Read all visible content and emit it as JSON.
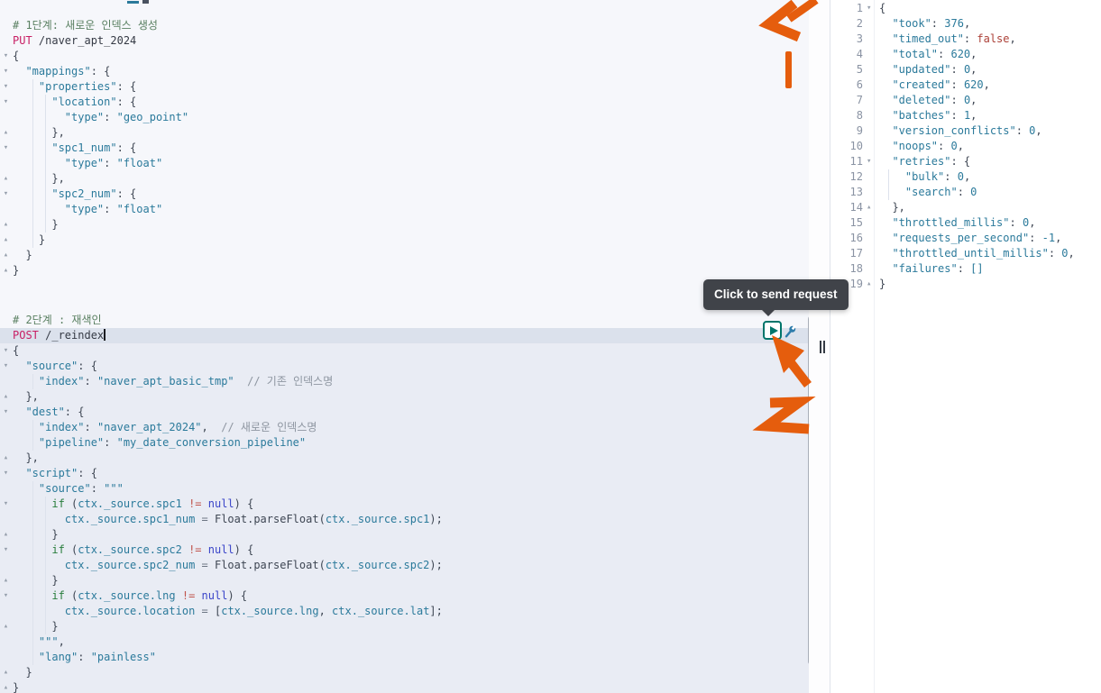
{
  "tooltip": {
    "text": "Click to send request"
  },
  "colors": {
    "accent_orange": "#e55d0d",
    "teal_action": "#00756b",
    "selection_line": "#dbe1ec"
  },
  "icons": {
    "play": "send-request",
    "wrench": "request-settings",
    "fold_open": "▾",
    "fold_close": "▴",
    "scroll_up": "▲",
    "scroll_down": "▼"
  },
  "annotations": {
    "items": [
      "arrow-pointing-down-left",
      "vertical-stroke",
      "arrow-pointing-to-send-button",
      "handwritten-digit-2"
    ]
  },
  "editor": {
    "blocks": [
      {
        "name": "request-block-1",
        "lines": [
          {
            "s": [
              [
                "cm",
                "# 1단계: 새로운 인덱스 생성"
              ]
            ]
          },
          {
            "s": [
              [
                "mth",
                "PUT "
              ],
              [
                "url",
                "/naver_apt_2024"
              ]
            ]
          },
          {
            "f": "o",
            "s": [
              [
                "pn",
                "{"
              ]
            ]
          },
          {
            "f": "o",
            "s": [
              [
                "t",
                "  \"mappings\""
              ],
              [
                "pn",
                ": {"
              ]
            ]
          },
          {
            "f": "o",
            "s": [
              [
                "t",
                "    \"properties\""
              ],
              [
                "pn",
                ": {"
              ]
            ]
          },
          {
            "f": "o",
            "s": [
              [
                "t",
                "      \"location\""
              ],
              [
                "pn",
                ": {"
              ]
            ]
          },
          {
            "s": [
              [
                "t",
                "        \"type\""
              ],
              [
                "pn",
                ": "
              ],
              [
                "t",
                "\"geo_point\""
              ]
            ]
          },
          {
            "f": "c",
            "s": [
              [
                "pn",
                "      },"
              ]
            ]
          },
          {
            "f": "o",
            "s": [
              [
                "t",
                "      \"spc1_num\""
              ],
              [
                "pn",
                ": {"
              ]
            ]
          },
          {
            "s": [
              [
                "t",
                "        \"type\""
              ],
              [
                "pn",
                ": "
              ],
              [
                "t",
                "\"float\""
              ]
            ]
          },
          {
            "f": "c",
            "s": [
              [
                "pn",
                "      },"
              ]
            ]
          },
          {
            "f": "o",
            "s": [
              [
                "t",
                "      \"spc2_num\""
              ],
              [
                "pn",
                ": {"
              ]
            ]
          },
          {
            "s": [
              [
                "t",
                "        \"type\""
              ],
              [
                "pn",
                ": "
              ],
              [
                "t",
                "\"float\""
              ]
            ]
          },
          {
            "f": "c",
            "s": [
              [
                "pn",
                "      }"
              ]
            ]
          },
          {
            "f": "c",
            "s": [
              [
                "pn",
                "    }"
              ]
            ]
          },
          {
            "f": "c",
            "s": [
              [
                "pn",
                "  }"
              ]
            ]
          },
          {
            "f": "c",
            "s": [
              [
                "pn",
                "}"
              ]
            ]
          }
        ]
      },
      {
        "name": "request-block-2",
        "lines": [
          {
            "s": [
              [
                "cm",
                "# 2단계 : 재색인"
              ]
            ]
          },
          {
            "sel": true,
            "cur": true,
            "s": [
              [
                "mth",
                "POST "
              ],
              [
                "url",
                "/_reindex"
              ]
            ]
          },
          {
            "f": "o",
            "s": [
              [
                "pn",
                "{"
              ]
            ]
          },
          {
            "f": "o",
            "s": [
              [
                "t",
                "  \"source\""
              ],
              [
                "pn",
                ": {"
              ]
            ]
          },
          {
            "s": [
              [
                "t",
                "    \"index\""
              ],
              [
                "pn",
                ": "
              ],
              [
                "t",
                "\"naver_apt_basic_tmp\""
              ],
              [
                "c2",
                "  // 기존 인덱스명"
              ]
            ]
          },
          {
            "f": "c",
            "s": [
              [
                "pn",
                "  },"
              ]
            ]
          },
          {
            "f": "o",
            "s": [
              [
                "t",
                "  \"dest\""
              ],
              [
                "pn",
                ": {"
              ]
            ]
          },
          {
            "s": [
              [
                "t",
                "    \"index\""
              ],
              [
                "pn",
                ": "
              ],
              [
                "t",
                "\"naver_apt_2024\""
              ],
              [
                "pn",
                ","
              ],
              [
                "c2",
                "  // 새로운 인덱스명"
              ]
            ]
          },
          {
            "s": [
              [
                "t",
                "    \"pipeline\""
              ],
              [
                "pn",
                ": "
              ],
              [
                "t",
                "\"my_date_conversion_pipeline\""
              ]
            ]
          },
          {
            "f": "c",
            "s": [
              [
                "pn",
                "  },"
              ]
            ]
          },
          {
            "f": "o",
            "s": [
              [
                "t",
                "  \"script\""
              ],
              [
                "pn",
                ": {"
              ]
            ]
          },
          {
            "s": [
              [
                "t",
                "    \"source\""
              ],
              [
                "pn",
                ": "
              ],
              [
                "t",
                "\"\"\""
              ]
            ]
          },
          {
            "f": "o",
            "s": [
              [
                "kw",
                "      if"
              ],
              [
                "pn",
                " ("
              ],
              [
                "t",
                "ctx._source.spc1"
              ],
              [
                "op",
                " !="
              ],
              [
                "nul",
                " null"
              ],
              [
                "pn",
                ") {"
              ]
            ]
          },
          {
            "s": [
              [
                "t",
                "        ctx._source.spc1_num"
              ],
              [
                "eq",
                " = "
              ],
              [
                "pn",
                "Float.parseFloat("
              ],
              [
                "t",
                "ctx._source.spc1"
              ],
              [
                "pn",
                ");"
              ]
            ]
          },
          {
            "f": "c",
            "s": [
              [
                "pn",
                "      }"
              ]
            ]
          },
          {
            "f": "o",
            "s": [
              [
                "kw",
                "      if"
              ],
              [
                "pn",
                " ("
              ],
              [
                "t",
                "ctx._source.spc2"
              ],
              [
                "op",
                " !="
              ],
              [
                "nul",
                " null"
              ],
              [
                "pn",
                ") {"
              ]
            ]
          },
          {
            "s": [
              [
                "t",
                "        ctx._source.spc2_num"
              ],
              [
                "eq",
                " = "
              ],
              [
                "pn",
                "Float.parseFloat("
              ],
              [
                "t",
                "ctx._source.spc2"
              ],
              [
                "pn",
                ");"
              ]
            ]
          },
          {
            "f": "c",
            "s": [
              [
                "pn",
                "      }"
              ]
            ]
          },
          {
            "f": "o",
            "s": [
              [
                "kw",
                "      if"
              ],
              [
                "pn",
                " ("
              ],
              [
                "t",
                "ctx._source.lng"
              ],
              [
                "op",
                " !="
              ],
              [
                "nul",
                " null"
              ],
              [
                "pn",
                ") {"
              ]
            ]
          },
          {
            "s": [
              [
                "t",
                "        ctx._source.location"
              ],
              [
                "eq",
                " = "
              ],
              [
                "pn",
                "["
              ],
              [
                "t",
                "ctx._source.lng"
              ],
              [
                "pn",
                ", "
              ],
              [
                "t",
                "ctx._source.lat"
              ],
              [
                "pn",
                "];"
              ]
            ]
          },
          {
            "f": "c",
            "s": [
              [
                "pn",
                "      }"
              ]
            ]
          },
          {
            "s": [
              [
                "t",
                "    \"\"\""
              ],
              [
                "pn",
                ","
              ]
            ]
          },
          {
            "s": [
              [
                "t",
                "    \"lang\""
              ],
              [
                "pn",
                ": "
              ],
              [
                "t",
                "\"painless\""
              ]
            ]
          },
          {
            "f": "c",
            "s": [
              [
                "pn",
                "  }"
              ]
            ]
          },
          {
            "f": "c",
            "s": [
              [
                "pn",
                "}"
              ]
            ]
          }
        ]
      }
    ]
  },
  "response": {
    "lines": [
      {
        "n": "1",
        "f": "o",
        "s": [
          [
            "pn",
            "{"
          ]
        ]
      },
      {
        "n": "2",
        "s": [
          [
            "t",
            "  \"took\""
          ],
          [
            "pn",
            ": "
          ],
          [
            "t",
            "376"
          ],
          [
            "pn",
            ","
          ]
        ]
      },
      {
        "n": "3",
        "s": [
          [
            "t",
            "  \"timed_out\""
          ],
          [
            "pn",
            ": "
          ],
          [
            "r",
            "false"
          ],
          [
            "pn",
            ","
          ]
        ]
      },
      {
        "n": "4",
        "s": [
          [
            "t",
            "  \"total\""
          ],
          [
            "pn",
            ": "
          ],
          [
            "t",
            "620"
          ],
          [
            "pn",
            ","
          ]
        ]
      },
      {
        "n": "5",
        "s": [
          [
            "t",
            "  \"updated\""
          ],
          [
            "pn",
            ": "
          ],
          [
            "t",
            "0"
          ],
          [
            "pn",
            ","
          ]
        ]
      },
      {
        "n": "6",
        "s": [
          [
            "t",
            "  \"created\""
          ],
          [
            "pn",
            ": "
          ],
          [
            "t",
            "620"
          ],
          [
            "pn",
            ","
          ]
        ]
      },
      {
        "n": "7",
        "s": [
          [
            "t",
            "  \"deleted\""
          ],
          [
            "pn",
            ": "
          ],
          [
            "t",
            "0"
          ],
          [
            "pn",
            ","
          ]
        ]
      },
      {
        "n": "8",
        "s": [
          [
            "t",
            "  \"batches\""
          ],
          [
            "pn",
            ": "
          ],
          [
            "t",
            "1"
          ],
          [
            "pn",
            ","
          ]
        ]
      },
      {
        "n": "9",
        "s": [
          [
            "t",
            "  \"version_conflicts\""
          ],
          [
            "pn",
            ": "
          ],
          [
            "t",
            "0"
          ],
          [
            "pn",
            ","
          ]
        ]
      },
      {
        "n": "10",
        "s": [
          [
            "t",
            "  \"noops\""
          ],
          [
            "pn",
            ": "
          ],
          [
            "t",
            "0"
          ],
          [
            "pn",
            ","
          ]
        ]
      },
      {
        "n": "11",
        "f": "o",
        "s": [
          [
            "t",
            "  \"retries\""
          ],
          [
            "pn",
            ": {"
          ]
        ]
      },
      {
        "n": "12",
        "s": [
          [
            "t",
            "    \"bulk\""
          ],
          [
            "pn",
            ": "
          ],
          [
            "t",
            "0"
          ],
          [
            "pn",
            ","
          ]
        ]
      },
      {
        "n": "13",
        "s": [
          [
            "t",
            "    \"search\""
          ],
          [
            "pn",
            ": "
          ],
          [
            "t",
            "0"
          ]
        ]
      },
      {
        "n": "14",
        "f": "c",
        "s": [
          [
            "pn",
            "  },"
          ]
        ]
      },
      {
        "n": "15",
        "s": [
          [
            "t",
            "  \"throttled_millis\""
          ],
          [
            "pn",
            ": "
          ],
          [
            "t",
            "0"
          ],
          [
            "pn",
            ","
          ]
        ]
      },
      {
        "n": "16",
        "s": [
          [
            "t",
            "  \"requests_per_second\""
          ],
          [
            "pn",
            ": "
          ],
          [
            "t",
            "-1"
          ],
          [
            "pn",
            ","
          ]
        ]
      },
      {
        "n": "17",
        "s": [
          [
            "t",
            "  \"throttled_until_millis\""
          ],
          [
            "pn",
            ": "
          ],
          [
            "t",
            "0"
          ],
          [
            "pn",
            ","
          ]
        ]
      },
      {
        "n": "18",
        "s": [
          [
            "t",
            "  \"failures\""
          ],
          [
            "pn",
            ": "
          ],
          [
            "t",
            "[]"
          ]
        ]
      },
      {
        "n": "19",
        "f": "c",
        "s": [
          [
            "pn",
            "}"
          ]
        ]
      }
    ]
  }
}
